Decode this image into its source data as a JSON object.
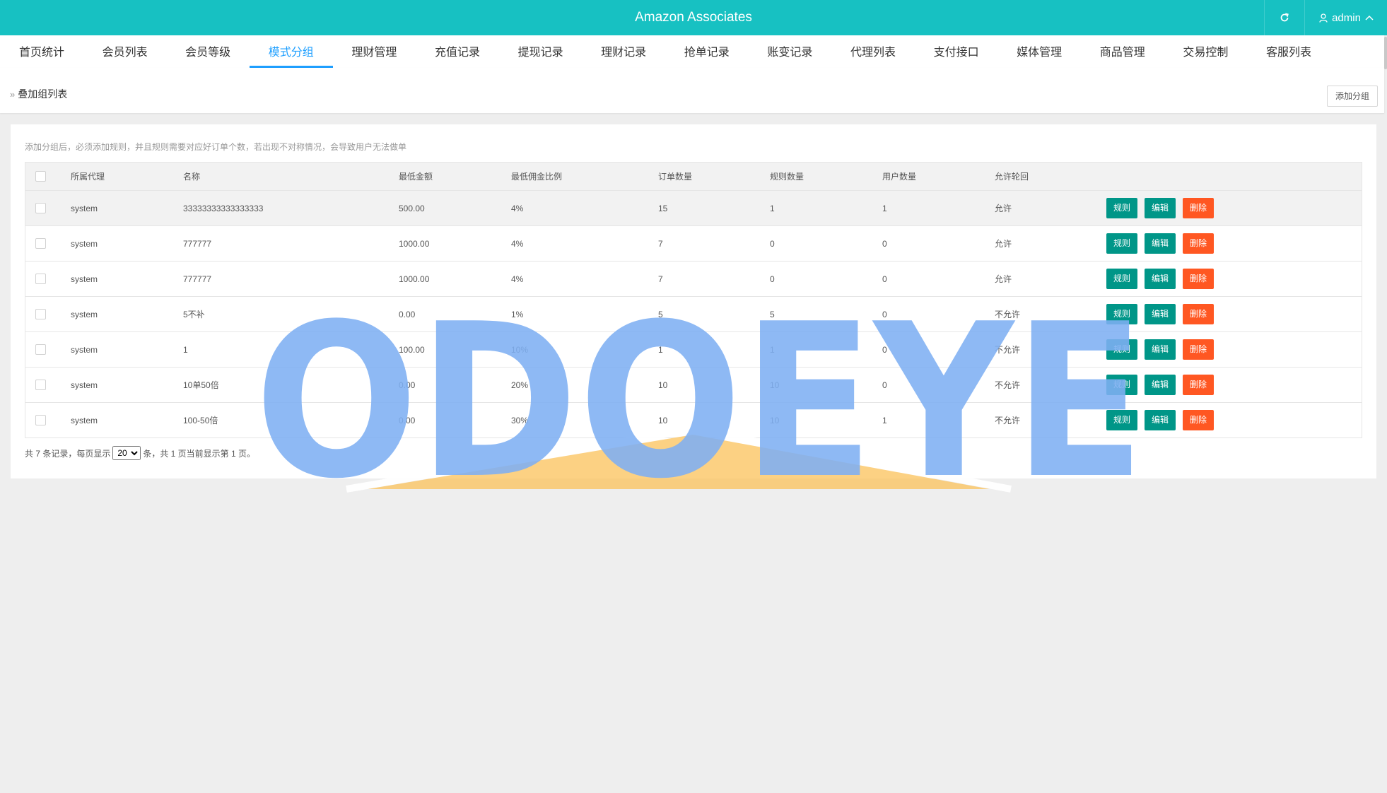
{
  "app": {
    "title": "Amazon Associates",
    "user": "admin"
  },
  "nav": {
    "tabs": [
      {
        "label": "首页统计"
      },
      {
        "label": "会员列表"
      },
      {
        "label": "会员等级"
      },
      {
        "label": "模式分组",
        "active": true
      },
      {
        "label": "理财管理"
      },
      {
        "label": "充值记录"
      },
      {
        "label": "提现记录"
      },
      {
        "label": "理财记录"
      },
      {
        "label": "抢单记录"
      },
      {
        "label": "账变记录"
      },
      {
        "label": "代理列表"
      },
      {
        "label": "支付接口"
      },
      {
        "label": "媒体管理"
      },
      {
        "label": "商品管理"
      },
      {
        "label": "交易控制"
      },
      {
        "label": "客服列表"
      }
    ]
  },
  "breadcrumb": {
    "text": "叠加组列表"
  },
  "toolbar": {
    "add_label": "添加分组"
  },
  "notice": "添加分组后，必须添加规则，并且规则需要对应好订单个数，若出现不对称情况，会导致用户无法做单",
  "table": {
    "headers": [
      "所属代理",
      "名称",
      "最低金额",
      "最低佣金比例",
      "订单数量",
      "规则数量",
      "用户数量",
      "允许轮回"
    ],
    "rows": [
      [
        "system",
        "33333333333333333",
        "500.00",
        "4%",
        "15",
        "1",
        "1",
        "允许"
      ],
      [
        "system",
        "777777",
        "1000.00",
        "4%",
        "7",
        "0",
        "0",
        "允许"
      ],
      [
        "system",
        "777777",
        "1000.00",
        "4%",
        "7",
        "0",
        "0",
        "允许"
      ],
      [
        "system",
        "5不补",
        "0.00",
        "1%",
        "5",
        "5",
        "0",
        "不允许"
      ],
      [
        "system",
        "1",
        "100.00",
        "10%",
        "1",
        "1",
        "0",
        "不允许"
      ],
      [
        "system",
        "10单50倍",
        "0.00",
        "20%",
        "10",
        "10",
        "0",
        "不允许"
      ],
      [
        "system",
        "100-50倍",
        "0.00",
        "30%",
        "10",
        "10",
        "1",
        "不允许"
      ]
    ],
    "actions": {
      "rule": "规则",
      "edit": "编辑",
      "delete": "删除"
    }
  },
  "pager": {
    "prefix": "共 7 条记录，每页显示",
    "page_size": "20",
    "suffix": "条，共 1 页当前显示第 1 页。"
  },
  "watermark": "ODOEYE",
  "colors": {
    "topbar": "#17c1c2",
    "active_tab": "#1e9fff",
    "btn_green": "#009688",
    "btn_red": "#ff5722"
  }
}
